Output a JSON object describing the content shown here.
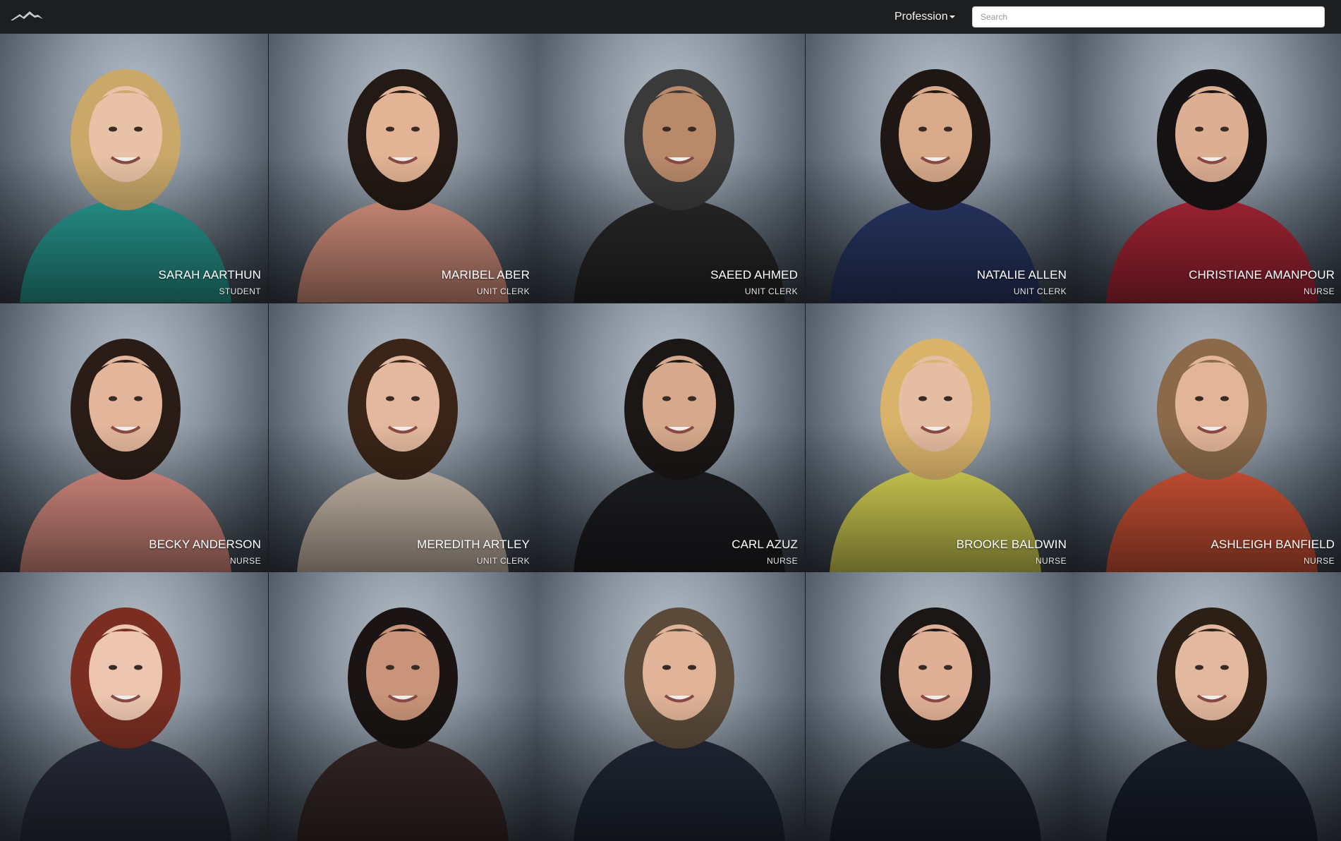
{
  "header": {
    "logo_icon": "mountain-logo-icon",
    "filter_label": "Profession",
    "filter_icon": "caret-down-icon",
    "search_placeholder": "Search",
    "search_value": ""
  },
  "people": [
    {
      "name": "SARAH AARTHUN",
      "profession": "STUDENT",
      "shirt": "#2aa39a",
      "hair": "#c9a86a",
      "skin": "#e8c2a6"
    },
    {
      "name": "MARIBEL ABER",
      "profession": "UNIT CLERK",
      "shirt": "#e59b86",
      "hair": "#241a15",
      "skin": "#e2b394"
    },
    {
      "name": "SAEED AHMED",
      "profession": "UNIT CLERK",
      "shirt": "#2a2a2c",
      "hair": "#3a3a3a",
      "skin": "#b98a6a"
    },
    {
      "name": "NATALIE ALLEN",
      "profession": "UNIT CLERK",
      "shirt": "#2b3a6a",
      "hair": "#1e1714",
      "skin": "#d8aa8a"
    },
    {
      "name": "CHRISTIANE AMANPOUR",
      "profession": "NURSE",
      "shirt": "#b5283a",
      "hair": "#161314",
      "skin": "#dcae92"
    },
    {
      "name": "BECKY ANDERSON",
      "profession": "NURSE",
      "shirt": "#e7968a",
      "hair": "#2a1d17",
      "skin": "#e3b69c"
    },
    {
      "name": "MEREDITH ARTLEY",
      "profession": "UNIT CLERK",
      "shirt": "#d8c7b6",
      "hair": "#3a2518",
      "skin": "#e3b89e"
    },
    {
      "name": "CARL AZUZ",
      "profession": "NURSE",
      "shirt": "#1f2023",
      "hair": "#1a1716",
      "skin": "#d6a98c"
    },
    {
      "name": "BROOKE BALDWIN",
      "profession": "NURSE",
      "shirt": "#e5e15a",
      "hair": "#d9b36a",
      "skin": "#e5bda2"
    },
    {
      "name": "ASHLEIGH BANFIELD",
      "profession": "NURSE",
      "shirt": "#e0593a",
      "hair": "#8a6a4a",
      "skin": "#e2b599"
    },
    {
      "name": "",
      "profession": "",
      "shirt": "#2c3040",
      "hair": "#7a2e22",
      "skin": "#ecc6b0"
    },
    {
      "name": "",
      "profession": "",
      "shirt": "#3a2a2a",
      "hair": "#1a1414",
      "skin": "#c99479"
    },
    {
      "name": "",
      "profession": "",
      "shirt": "#232a3a",
      "hair": "#5a4a3a",
      "skin": "#e1b398"
    },
    {
      "name": "",
      "profession": "",
      "shirt": "#1f2530",
      "hair": "#1a1716",
      "skin": "#e0b096"
    },
    {
      "name": "",
      "profession": "",
      "shirt": "#1c2230",
      "hair": "#2c1f16",
      "skin": "#e2b89e"
    }
  ]
}
